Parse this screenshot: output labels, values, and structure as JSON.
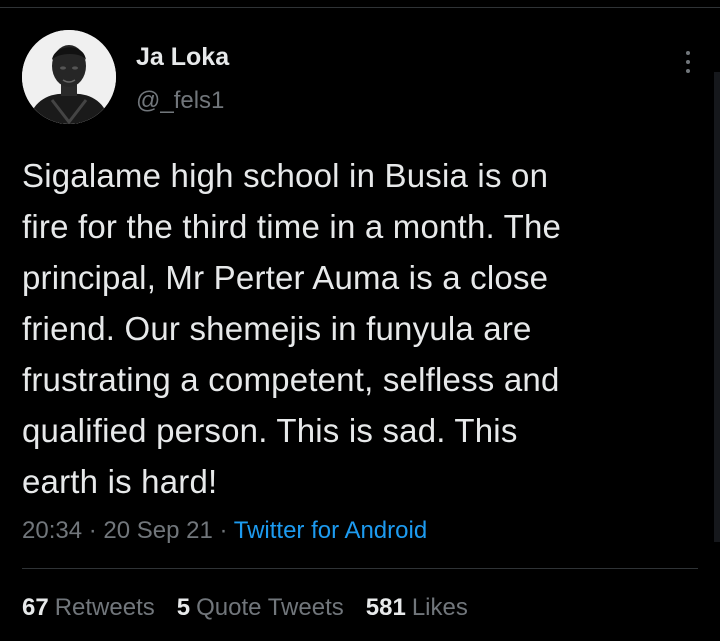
{
  "colors": {
    "background": "#000000",
    "text_primary": "#e7e9ea",
    "text_secondary": "#71767b",
    "link_blue": "#1d9bf0",
    "divider": "#2f3336"
  },
  "author": {
    "display_name": "Ja Loka",
    "handle": "@_fels1",
    "avatar_icon": "profile-photo"
  },
  "more_icon": "ellipsis-vertical-icon",
  "tweet": {
    "lines": [
      "Sigalame high school in Busia is on",
      "fire for the third time in a month. The",
      "principal, Mr Perter Auma is a close",
      "friend. Our shemejis in funyula are",
      "frustrating a competent, selfless and",
      "qualified person. This is sad. This",
      "earth is hard!"
    ]
  },
  "meta": {
    "time": "20:34",
    "separator": "·",
    "date": "20 Sep 21",
    "source": "Twitter for Android"
  },
  "stats": {
    "retweets_count": "67",
    "retweets_label": "Retweets",
    "quotes_count": "5",
    "quotes_label": "Quote Tweets",
    "likes_count": "581",
    "likes_label": "Likes"
  }
}
